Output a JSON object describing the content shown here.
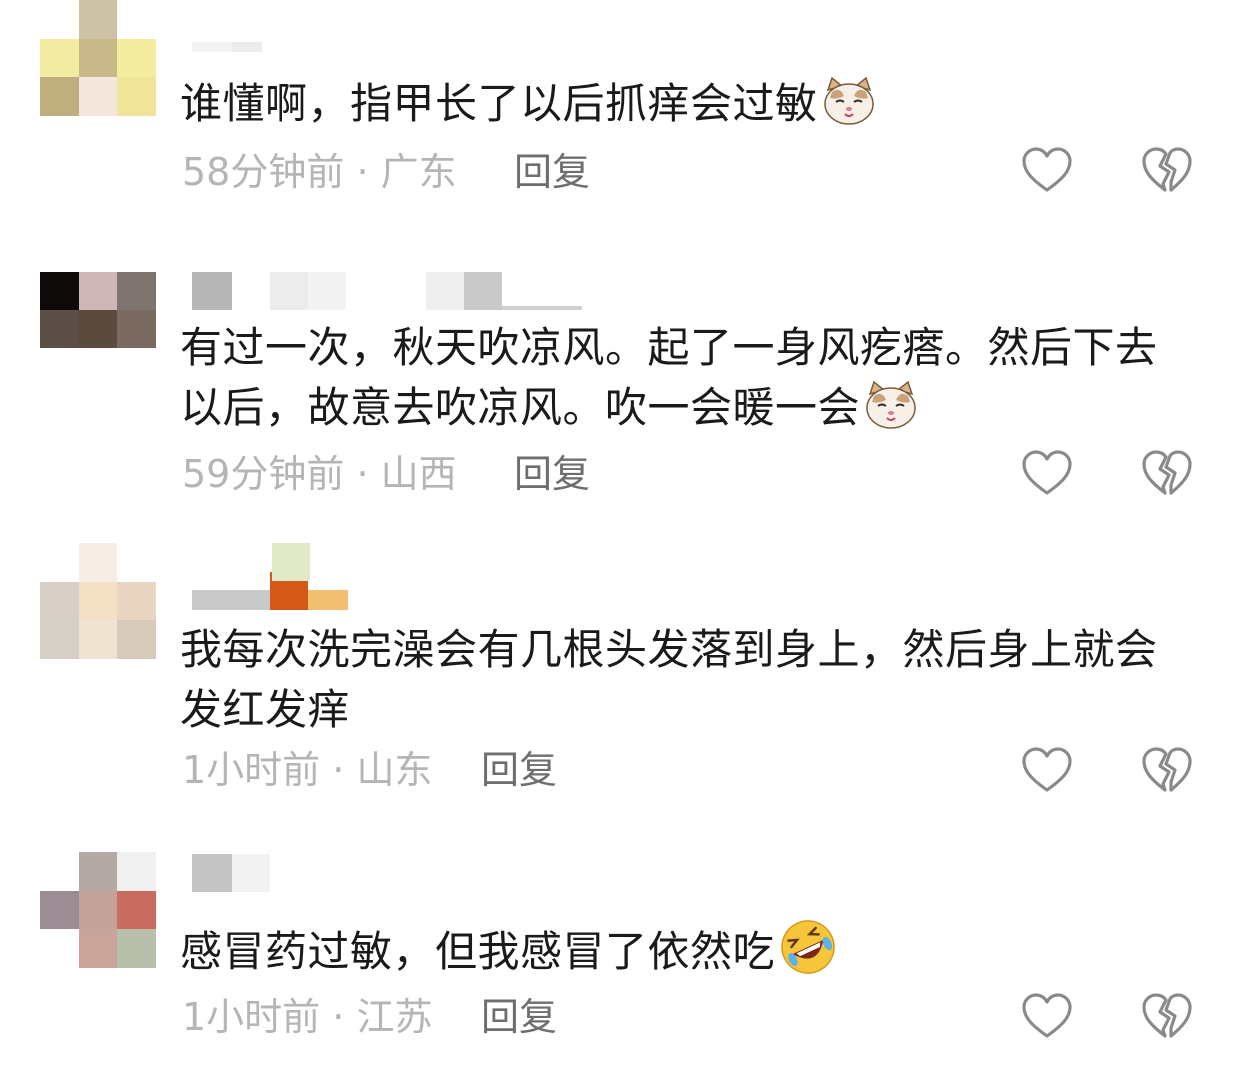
{
  "colors": {
    "text": "#1a1a1a",
    "meta": "#b5b5b5",
    "reply": "#6e6e6e",
    "icon_stroke": "#8a8a8a"
  },
  "icons": {
    "like": "heart-outline-icon",
    "dislike": "broken-heart-outline-icon",
    "cat_emoji": "cat-face-emoji",
    "laugh_emoji": "rolling-laughing-emoji"
  },
  "comments": [
    {
      "text": "谁懂啊，指甲长了以后抓痒会过敏",
      "emoji": "cat",
      "time": "58分钟前",
      "location": "广东",
      "reply_label": "回复"
    },
    {
      "text": "有过一次，秋天吹凉风。起了一身风疙瘩。然后下去以后，故意去吹凉风。吹一会暖一会",
      "emoji": "cat",
      "time": "59分钟前",
      "location": "山西",
      "reply_label": "回复"
    },
    {
      "text": "我每次洗完澡会有几根头发落到身上，然后身上就会发红发痒",
      "emoji": "",
      "time": "1小时前",
      "location": "山东",
      "reply_label": "回复"
    },
    {
      "text": "感冒药过敏，但我感冒了依然吃",
      "emoji": "laugh",
      "time": "1小时前",
      "location": "江苏",
      "reply_label": "回复"
    }
  ]
}
